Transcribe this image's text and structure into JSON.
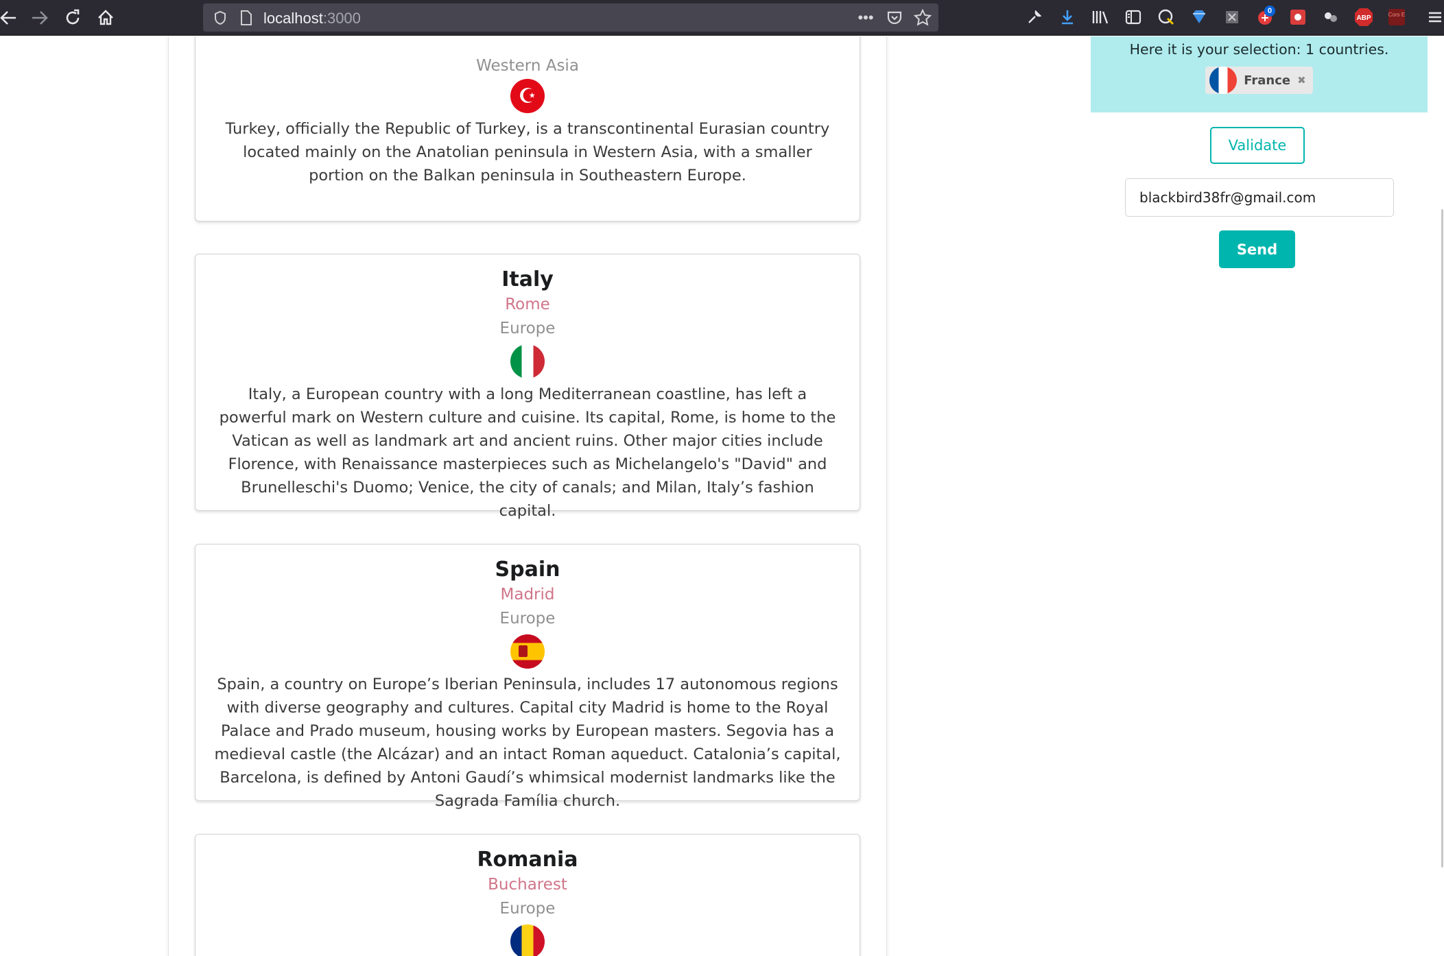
{
  "browser": {
    "url_host": "localhost",
    "url_port": ":3000",
    "nav_icons": [
      "back-arrow-icon",
      "forward-arrow-icon",
      "reload-icon",
      "home-icon"
    ],
    "url_icons": [
      "shield-icon",
      "page-icon"
    ],
    "url_actions": [
      "more-icon",
      "pocket-icon",
      "star-icon"
    ],
    "extensions": [
      "wrench-icon",
      "download-icon",
      "library-icon",
      "sidebar-icon",
      "extension-icon",
      "diamond-icon",
      "extension-icon",
      "extension-icon",
      "extension-icon",
      "extension-icon",
      "adblock-icon",
      "extension-icon",
      "menu-icon"
    ],
    "ext_badge": "0",
    "abp_label": "ABP",
    "cors_label": "Cors E"
  },
  "countries": [
    {
      "name": "",
      "capital": "",
      "region": "Western Asia",
      "flag": "turkey-flag-icon",
      "description": "Turkey, officially the Republic of Turkey, is a transcontinental Eurasian country located mainly on the Anatolian peninsula in Western Asia, with a smaller portion on the Balkan peninsula in Southeastern Europe."
    },
    {
      "name": "Italy",
      "capital": "Rome",
      "region": "Europe",
      "flag": "italy-flag-icon",
      "description": "Italy, a European country with a long Mediterranean coastline, has left a powerful mark on Western culture and cuisine. Its capital, Rome, is home to the Vatican as well as landmark art and ancient ruins. Other major cities include Florence, with Renaissance masterpieces such as Michelangelo's \"David\" and Brunelleschi's Duomo; Venice, the city of canals; and Milan, Italy’s fashion capital."
    },
    {
      "name": "Spain",
      "capital": "Madrid",
      "region": "Europe",
      "flag": "spain-flag-icon",
      "description": "Spain, a country on Europe’s Iberian Peninsula, includes 17 autonomous regions with diverse geography and cultures. Capital city Madrid is home to the Royal Palace and Prado museum, housing works by European masters. Segovia has a medieval castle (the Alcázar) and an intact Roman aqueduct. Catalonia’s capital, Barcelona, is defined by Antoni Gaudí’s whimsical modernist landmarks like the Sagrada Família church."
    },
    {
      "name": "Romania",
      "capital": "Bucharest",
      "region": "Europe",
      "flag": "romania-flag-icon",
      "description": ""
    }
  ],
  "selection": {
    "text": "Here it is your selection: 1 countries.",
    "chip_label": "France",
    "chip_flag": "france-flag-icon",
    "chip_remove": "✖"
  },
  "actions": {
    "validate_label": "Validate",
    "email_value": "blackbird38fr@gmail.com",
    "send_label": "Send"
  }
}
